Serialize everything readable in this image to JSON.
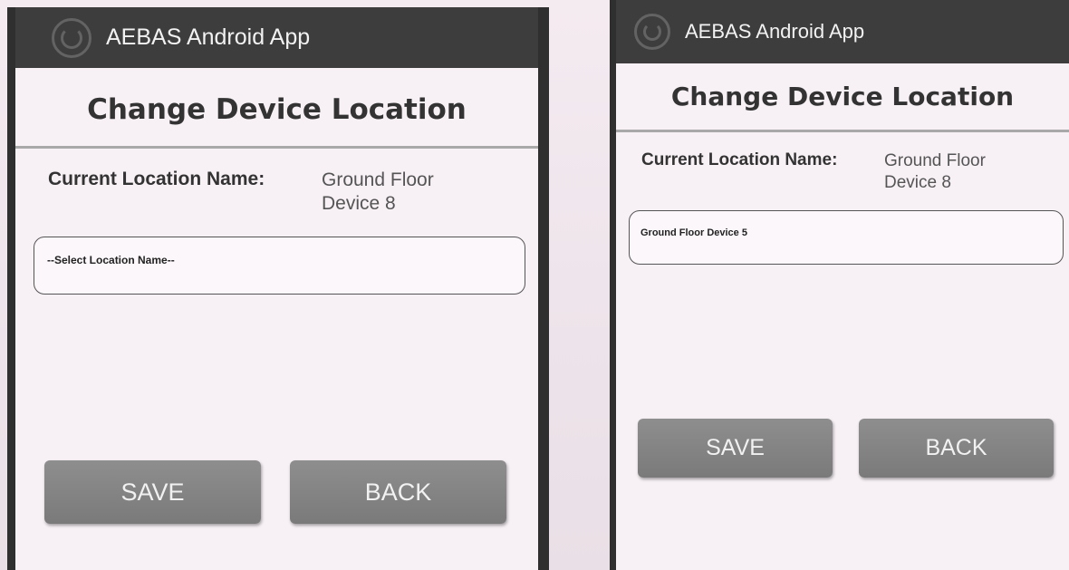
{
  "left_screen": {
    "app_title": "AEBAS Android App",
    "heading": "Change Device Location",
    "current_location_label": "Current Location Name:",
    "current_location_value": "Ground Floor Device 8",
    "location_select_value": "--Select Location Name--",
    "save_label": "SAVE",
    "back_label": "BACK"
  },
  "right_screen": {
    "app_title": "AEBAS Android App",
    "heading": "Change Device Location",
    "current_location_label": "Current Location Name:",
    "current_location_value": "Ground Floor Device 8",
    "location_select_value": "Ground Floor Device 5",
    "save_label": "SAVE",
    "back_label": "BACK"
  },
  "icons": {
    "app_logo": "spiral-logo-icon"
  },
  "colors": {
    "titlebar": "#3d3d3d",
    "button": "#858585",
    "background": "#f7f1f5"
  }
}
